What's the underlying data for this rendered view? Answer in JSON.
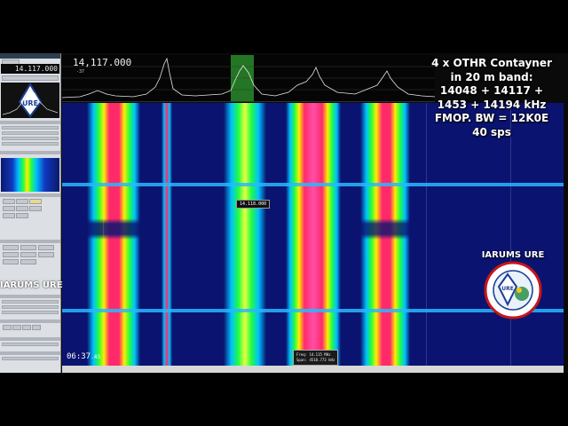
{
  "caption": {
    "lines": [
      "4 x OTHR Contayner",
      "in 20 m band:",
      "14048 + 14117 +",
      "1453 + 14194 kHz",
      "FMOP. BW = 12K0E",
      "40 sps"
    ]
  },
  "app": {
    "frequency": "14,117.000",
    "panel_frequency": "14.117.000",
    "scale_label": "-37"
  },
  "clock": {
    "time": "06:37",
    "seconds": ".43"
  },
  "tooltip": {
    "frequency": "14.118.000"
  },
  "span_box": {
    "freq_line": "Freq: 14.115 MHz",
    "span_line": "Span: 4510.773 kHz"
  },
  "watermark": {
    "left_text": "IARUMS URE",
    "logo_title": "IARUMS URE"
  },
  "colors": {
    "waterfall_bg": "#0a1470",
    "hot": "#ff2a6a",
    "mid": "#ffee00",
    "cool": "#20ff40",
    "cold": "#00c0ff"
  }
}
